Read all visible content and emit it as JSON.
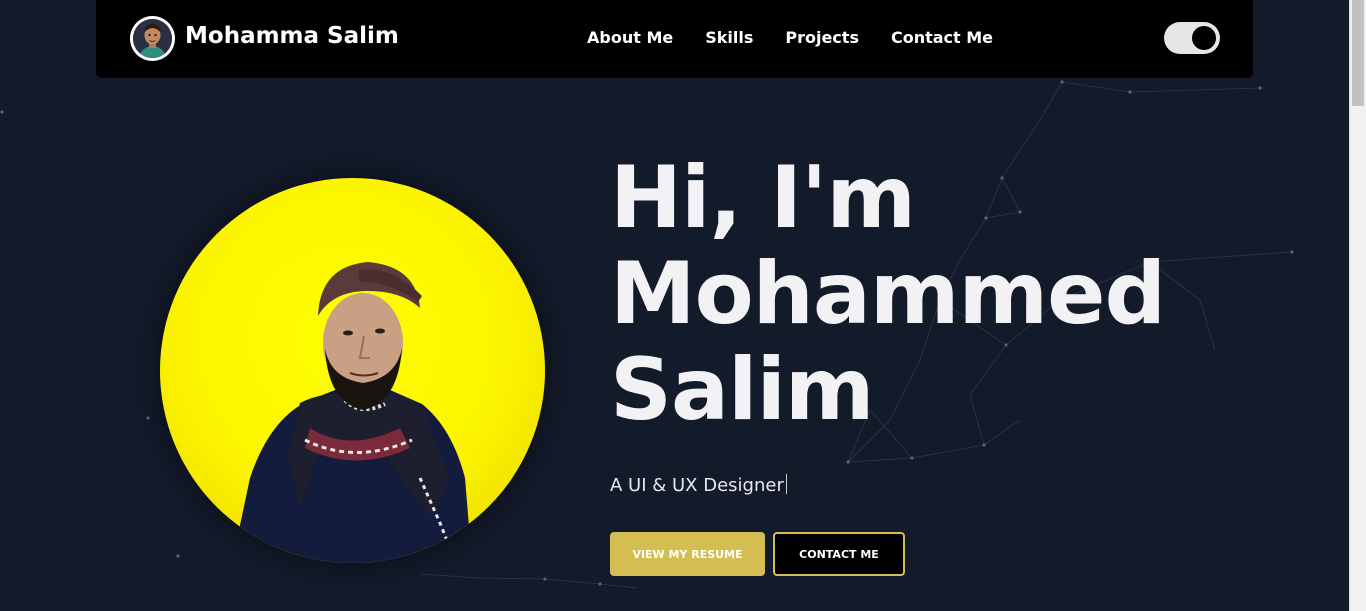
{
  "brand": {
    "name": "Mohamma Salim"
  },
  "nav": {
    "links": [
      "About Me",
      "Skills",
      "Projects",
      "Contact Me"
    ]
  },
  "theme_toggle": {
    "state": "on"
  },
  "hero": {
    "title_lines": [
      "Hi, I'm",
      "Mohammed",
      "Salim"
    ],
    "subtitle": "A UI & UX Designer",
    "buttons": {
      "resume": "VIEW MY RESUME",
      "contact": "CONTACT ME"
    }
  },
  "colors": {
    "background": "#131a2a",
    "navbar": "#000000",
    "accent_yellow": "#d4bd51",
    "photo_bg": "#ffff00"
  }
}
